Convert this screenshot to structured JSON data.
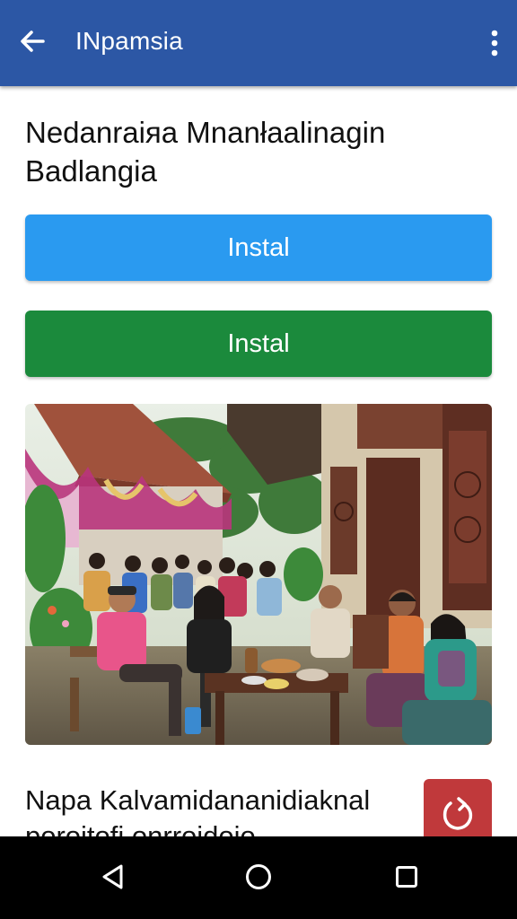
{
  "app_bar": {
    "title": "INpamsia",
    "back_icon": "arrow-back-icon",
    "menu_icon": "more-vert-icon",
    "background": "#2c57a5"
  },
  "main": {
    "headline": "Nedanraiяa Mnanłaalinagin Badlangia",
    "buttons": [
      {
        "label": "Instal",
        "color": "#2a9af0"
      },
      {
        "label": "Instal",
        "color": "#1b8a3c"
      }
    ],
    "card": {
      "title": "Napa Kalvamidananidiaknal poroitofi onrroidoio",
      "action_icon": "refresh-icon",
      "action_color": "#c0393b"
    }
  },
  "system_nav": {
    "back_icon": "nav-back-icon",
    "home_icon": "nav-home-icon",
    "recents_icon": "nav-recents-icon"
  }
}
